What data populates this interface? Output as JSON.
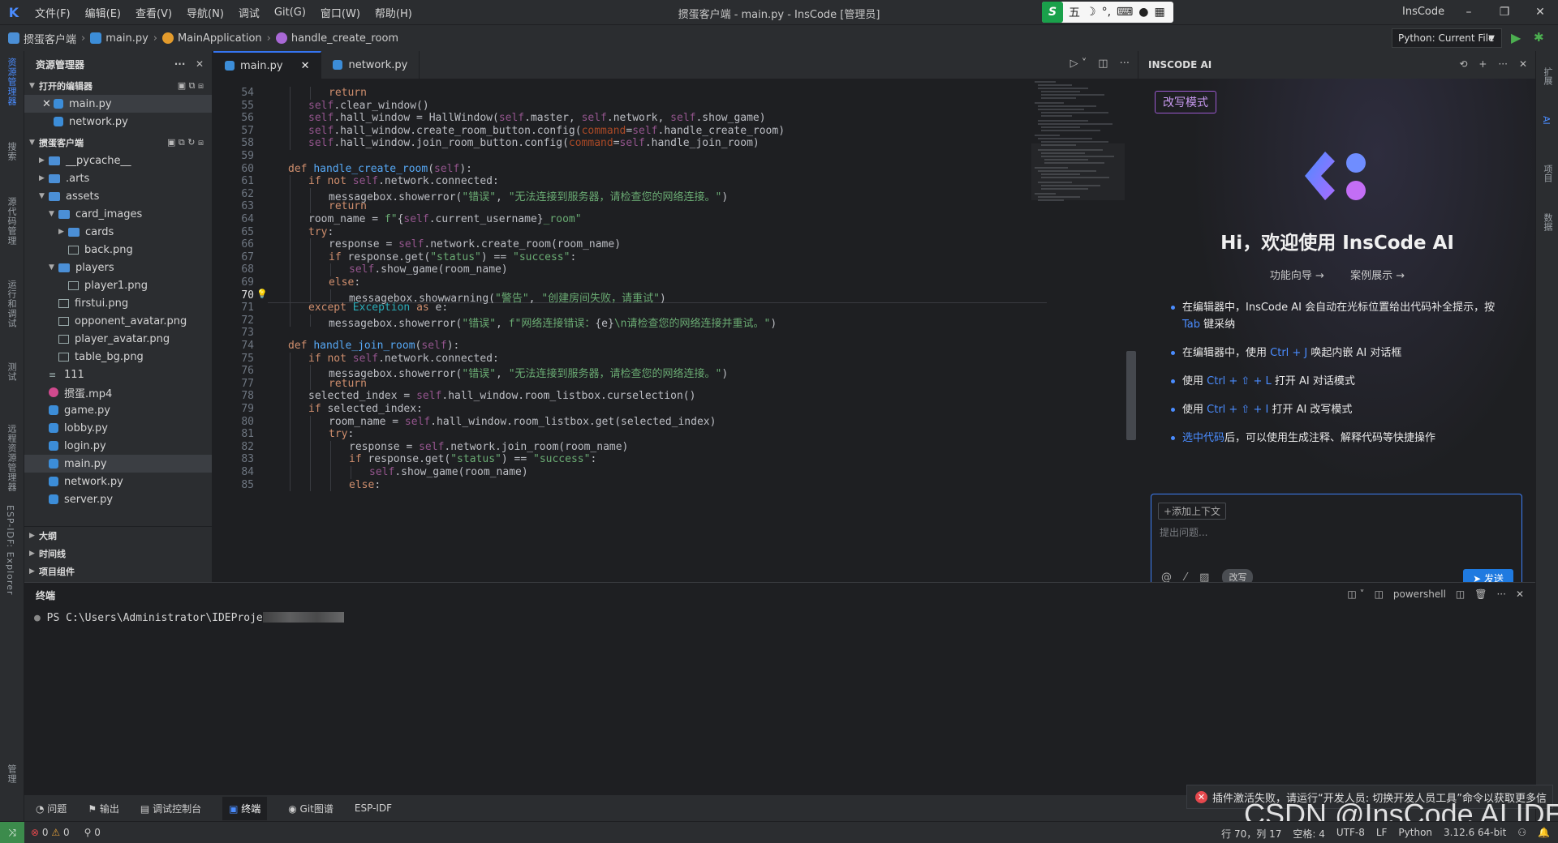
{
  "titlebar": {
    "menu": [
      "文件(F)",
      "编辑(E)",
      "查看(V)",
      "导航(N)",
      "调试",
      "Git(G)",
      "窗口(W)",
      "帮助(H)"
    ],
    "title": "掼蛋客户端 - main.py - InsCode [管理员]",
    "ime": "五",
    "user": "InsCode"
  },
  "breadcrumb": {
    "project": "掼蛋客户端",
    "file": "main.py",
    "cls": "MainApplication",
    "method": "handle_create_room"
  },
  "run_config": "Python: Current File",
  "activity": {
    "left": [
      "资源管理器",
      "搜索",
      "源代码管理",
      "运行和调试",
      "测试",
      "远程资源管理器",
      "ESP-IDF: Explorer",
      "管理"
    ],
    "right": [
      "扩展",
      "AI",
      "项目",
      "数据"
    ]
  },
  "explorer": {
    "title": "资源管理器",
    "open_editors_title": "打开的编辑器",
    "open_editors": [
      "main.py",
      "network.py"
    ],
    "project_title": "掼蛋客户端",
    "tree": [
      {
        "name": "__pycache__",
        "type": "folder",
        "depth": 1,
        "open": false
      },
      {
        "name": ".arts",
        "type": "folder",
        "depth": 1,
        "open": false
      },
      {
        "name": "assets",
        "type": "folder",
        "depth": 1,
        "open": true
      },
      {
        "name": "card_images",
        "type": "folder",
        "depth": 2,
        "open": true
      },
      {
        "name": "cards",
        "type": "folder",
        "depth": 3,
        "open": false
      },
      {
        "name": "back.png",
        "type": "img",
        "depth": 3
      },
      {
        "name": "players",
        "type": "folder",
        "depth": 2,
        "open": true
      },
      {
        "name": "player1.png",
        "type": "img",
        "depth": 3
      },
      {
        "name": "firstui.png",
        "type": "img",
        "depth": 2
      },
      {
        "name": "opponent_avatar.png",
        "type": "img",
        "depth": 2
      },
      {
        "name": "player_avatar.png",
        "type": "img",
        "depth": 2
      },
      {
        "name": "table_bg.png",
        "type": "img",
        "depth": 2
      },
      {
        "name": "111",
        "type": "txt",
        "depth": 1
      },
      {
        "name": "掼蛋.mp4",
        "type": "mp4",
        "depth": 1
      },
      {
        "name": "game.py",
        "type": "py",
        "depth": 1
      },
      {
        "name": "lobby.py",
        "type": "py",
        "depth": 1
      },
      {
        "name": "login.py",
        "type": "py",
        "depth": 1
      },
      {
        "name": "main.py",
        "type": "py",
        "depth": 1,
        "selected": true
      },
      {
        "name": "network.py",
        "type": "py",
        "depth": 1
      },
      {
        "name": "server.py",
        "type": "py",
        "depth": 1
      }
    ],
    "sections": [
      "大纲",
      "时间线",
      "项目组件"
    ]
  },
  "editor": {
    "tabs": [
      {
        "label": "main.py",
        "active": true
      },
      {
        "label": "network.py",
        "active": false
      }
    ],
    "current_line": "70",
    "lines": [
      {
        "n": "54",
        "h": "<span class=\"kw\">return</span>",
        "i": 3
      },
      {
        "n": "55",
        "h": "<span class=\"sf\">self</span>.clear_window()",
        "i": 2
      },
      {
        "n": "56",
        "h": "<span class=\"sf\">self</span>.hall_window = HallWindow(<span class=\"sf\">self</span>.master, <span class=\"sf\">self</span>.network, <span class=\"sf\">self</span>.show_game)",
        "i": 2
      },
      {
        "n": "57",
        "h": "<span class=\"sf\">self</span>.hall_window.create_room_button.config(<span class=\"prm\">command</span>=<span class=\"sf\">self</span>.handle_create_room)",
        "i": 2
      },
      {
        "n": "58",
        "h": "<span class=\"sf\">self</span>.hall_window.join_room_button.config(<span class=\"prm\">command</span>=<span class=\"sf\">self</span>.handle_join_room)",
        "i": 2
      },
      {
        "n": "59",
        "h": "",
        "i": 0
      },
      {
        "n": "60",
        "h": "<span class=\"kw\">def</span> <span class=\"fn\">handle_create_room</span>(<span class=\"sf\">self</span>):",
        "i": 1
      },
      {
        "n": "61",
        "h": "<span class=\"kw\">if not</span> <span class=\"sf\">self</span>.network.connected:",
        "i": 2
      },
      {
        "n": "62",
        "h": "messagebox.showerror(<span class=\"st\">\"错误\"</span>, <span class=\"st\">\"无法连接到服务器，请检查您的网络连接。\"</span>)",
        "i": 3
      },
      {
        "n": "63",
        "h": "<span class=\"kw\">return</span>",
        "i": 3
      },
      {
        "n": "64",
        "h": "room_name = <span class=\"st\">f\"</span>{<span class=\"sf\">self</span>.current_username}<span class=\"st\">_room\"</span>",
        "i": 2
      },
      {
        "n": "65",
        "h": "<span class=\"kw\">try</span>:",
        "i": 2
      },
      {
        "n": "66",
        "h": "response = <span class=\"sf\">self</span>.network.create_room(room_name)",
        "i": 3
      },
      {
        "n": "67",
        "h": "<span class=\"kw\">if</span> response.get(<span class=\"st\">\"status\"</span>) == <span class=\"st\">\"success\"</span>:",
        "i": 3
      },
      {
        "n": "68",
        "h": "<span class=\"sf\">self</span>.show_game(room_name)",
        "i": 4
      },
      {
        "n": "69",
        "h": "<span class=\"kw\">else</span>:",
        "i": 3
      },
      {
        "n": "70",
        "h": "messagebox.showwarning(<span class=\"st\">\"警告\"</span>, <span class=\"st\">\"创建房间失败，请重试\"</span>)",
        "i": 4
      },
      {
        "n": "71",
        "h": "<span class=\"kw\">except</span> <span class=\"nb\">Exception</span> <span class=\"kw\">as</span> e:",
        "i": 2
      },
      {
        "n": "72",
        "h": "messagebox.showerror(<span class=\"st\">\"错误\"</span>, <span class=\"st\">f\"网络连接错误：</span>{e}<span class=\"st\">\\n请检查您的网络连接并重试。\"</span>)",
        "i": 3
      },
      {
        "n": "73",
        "h": "",
        "i": 0
      },
      {
        "n": "74",
        "h": "<span class=\"kw\">def</span> <span class=\"fn\">handle_join_room</span>(<span class=\"sf\">self</span>):",
        "i": 1
      },
      {
        "n": "75",
        "h": "<span class=\"kw\">if not</span> <span class=\"sf\">self</span>.network.connected:",
        "i": 2
      },
      {
        "n": "76",
        "h": "messagebox.showerror(<span class=\"st\">\"错误\"</span>, <span class=\"st\">\"无法连接到服务器，请检查您的网络连接。\"</span>)",
        "i": 3
      },
      {
        "n": "77",
        "h": "<span class=\"kw\">return</span>",
        "i": 3
      },
      {
        "n": "78",
        "h": "selected_index = <span class=\"sf\">self</span>.hall_window.room_listbox.curselection()",
        "i": 2
      },
      {
        "n": "79",
        "h": "<span class=\"kw\">if</span> selected_index:",
        "i": 2
      },
      {
        "n": "80",
        "h": "room_name = <span class=\"sf\">self</span>.hall_window.room_listbox.get(selected_index)",
        "i": 3
      },
      {
        "n": "81",
        "h": "<span class=\"kw\">try</span>:",
        "i": 3
      },
      {
        "n": "82",
        "h": "response = <span class=\"sf\">self</span>.network.join_room(room_name)",
        "i": 4
      },
      {
        "n": "83",
        "h": "<span class=\"kw\">if</span> response.get(<span class=\"st\">\"status\"</span>) == <span class=\"st\">\"success\"</span>:",
        "i": 4
      },
      {
        "n": "84",
        "h": "<span class=\"sf\">self</span>.show_game(room_name)",
        "i": 5
      },
      {
        "n": "85",
        "h": "<span class=\"kw\">else</span>:",
        "i": 4
      }
    ]
  },
  "ai": {
    "title": "INSCODE AI",
    "mode": "改写模式",
    "welcome": "Hi，欢迎使用 InsCode AI",
    "links": [
      "功能向导 →",
      "案例展示 →"
    ],
    "tips": [
      {
        "pre": "在编辑器中，InsCode AI 会自动在光标位置给出代码补全提示，按 ",
        "hl": "Tab",
        "post": " 键采纳"
      },
      {
        "pre": "在编辑器中，使用 ",
        "hl": "Ctrl + J",
        "post": " 唤起内嵌 AI 对话框"
      },
      {
        "pre": "使用 ",
        "hl": "Ctrl + ⇧ + L",
        "post": " 打开 AI 对话模式"
      },
      {
        "pre": "使用 ",
        "hl": "Ctrl + ⇧ + I",
        "post": " 打开 AI 改写模式"
      },
      {
        "pre": "",
        "hl": "选中代码",
        "post": "后，可以使用生成注释、解释代码等快捷操作"
      }
    ],
    "add_context": "+添加上下文",
    "placeholder": "提出问题...",
    "rewrite_chip": "改写",
    "send": "发送"
  },
  "panel": {
    "title": "终端",
    "shell": "powershell",
    "prompt": "PS C:\\Users\\Administrator\\IDEProje"
  },
  "bottom_tabs": [
    "问题",
    "输出",
    "调试控制台",
    "终端",
    "Git图谱",
    "ESP-IDF"
  ],
  "notification": "插件激活失败，请运行“开发人员: 切换开发人员工具”命令以获取更多信",
  "watermark": "CSDN @InsCode AI IDE",
  "status": {
    "errors": "0",
    "warnings": "0",
    "ports": "0",
    "position": "行 70，列 17",
    "spaces": "空格: 4",
    "encoding": "UTF-8",
    "eol": "LF",
    "lang": "Python",
    "interp": "3.12.6 64-bit"
  }
}
